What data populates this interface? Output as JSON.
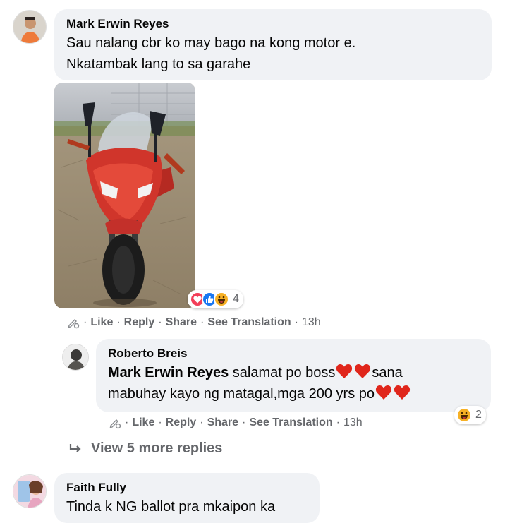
{
  "comments": [
    {
      "author": "Mark Erwin Reyes",
      "lines": [
        "Sau nalang cbr ko may bago na kong motor e.",
        "Nkatambak lang to sa garahe"
      ],
      "reaction_count": "4",
      "reactions": [
        "love-icon",
        "like-icon",
        "haha-icon"
      ],
      "actions": {
        "like": "Like",
        "reply": "Reply",
        "share": "Share",
        "translate": "See Translation",
        "time": "13h"
      }
    }
  ],
  "reply": {
    "author": "Roberto Breis",
    "mention": "Mark Erwin Reyes",
    "text_part1": " salamat po boss",
    "text_part2": "sana",
    "text_line2": "mabuhay kayo ng matagal,mga 200 yrs po",
    "reaction_count": "2",
    "reactions": [
      "haha-icon"
    ],
    "actions": {
      "like": "Like",
      "reply": "Reply",
      "share": "Share",
      "translate": "See Translation",
      "time": "13h"
    }
  },
  "view_more": "View 5 more replies",
  "last_comment": {
    "author": "Faith Fully",
    "text": "Tinda k NG ballot pra mkaipon ka"
  },
  "colors": {
    "bubble": "#f0f2f5",
    "meta": "#65676b",
    "love": "#f33e58",
    "like": "#1877f2",
    "haha": "#f7b125"
  }
}
